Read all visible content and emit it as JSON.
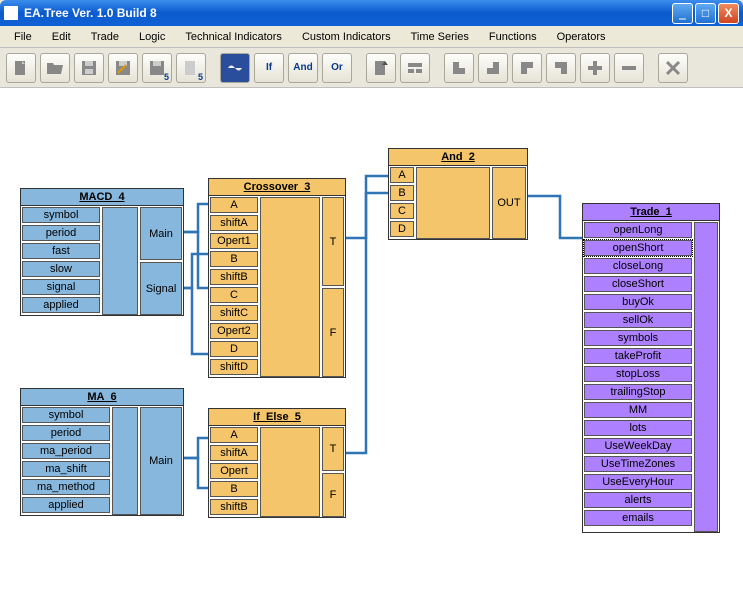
{
  "window": {
    "title": "EA.Tree Ver. 1.0 Build 8"
  },
  "menu": {
    "items": [
      "File",
      "Edit",
      "Trade",
      "Logic",
      "Technical Indicators",
      "Custom Indicators",
      "Time Series",
      "Functions",
      "Operators"
    ]
  },
  "toolbar": {
    "b_if": "If",
    "b_and": "And",
    "b_or": "Or",
    "b_save5a": "5",
    "b_save5b": "5"
  },
  "nodes": {
    "macd4": {
      "title": "MACD_4",
      "ports_left": [
        "symbol",
        "period",
        "fast",
        "slow",
        "signal",
        "applied"
      ],
      "ports_right": [
        "Main",
        "Signal"
      ]
    },
    "ma6": {
      "title": "MA_6",
      "ports_left": [
        "symbol",
        "period",
        "ma_period",
        "ma_shift",
        "ma_method",
        "applied"
      ],
      "ports_right": [
        "Main"
      ]
    },
    "cross3": {
      "title": "Crossover_3",
      "ports_left": [
        "A",
        "shiftA",
        "Opert1",
        "B",
        "shiftB",
        "C",
        "shiftC",
        "Opert2",
        "D",
        "shiftD"
      ],
      "ports_right": [
        "T",
        "F"
      ]
    },
    "ifelse5": {
      "title": "If_Else_5",
      "ports_left": [
        "A",
        "shiftA",
        "Opert",
        "B",
        "shiftB"
      ],
      "ports_right": [
        "T",
        "F"
      ]
    },
    "and2": {
      "title": "And_2",
      "ports_left": [
        "A",
        "B",
        "C",
        "D"
      ],
      "ports_right": [
        "OUT"
      ]
    },
    "trade1": {
      "title": "Trade_1",
      "ports_left": [
        "openLong",
        "openShort",
        "closeLong",
        "closeShort",
        "buyOk",
        "sellOk",
        "symbols",
        "takeProfit",
        "stopLoss",
        "trailingStop",
        "MM",
        "lots",
        "UseWeekDay",
        "UseTimeZones",
        "UseEveryHour",
        "alerts",
        "emails"
      ]
    }
  }
}
